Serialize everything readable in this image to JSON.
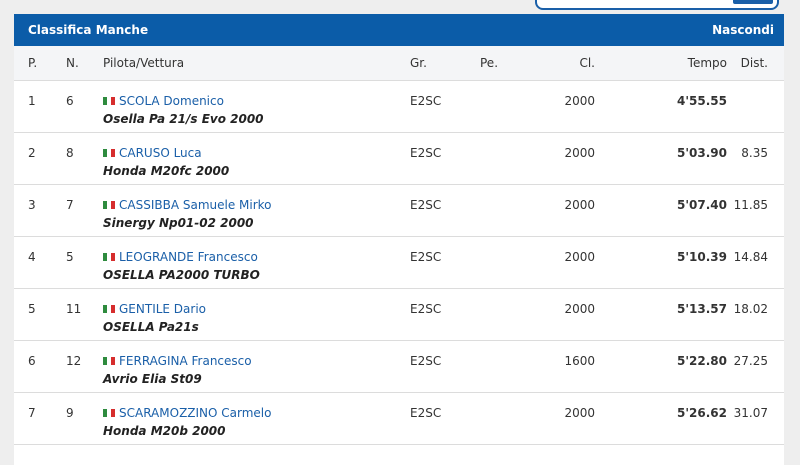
{
  "panel": {
    "title": "Classifica Manche",
    "toggle_label": "Nascondi"
  },
  "columns": {
    "pos": "P.",
    "num": "N.",
    "pilot": "Pilota/Vettura",
    "gr": "Gr.",
    "pe": "Pe.",
    "cl": "Cl.",
    "tempo": "Tempo",
    "dist": "Dist."
  },
  "rows": [
    {
      "pos": "1",
      "num": "6",
      "driver": "SCOLA Domenico",
      "car": "Osella Pa 21/s Evo 2000",
      "gr": "E2SC",
      "pe": "",
      "cl": "2000",
      "tempo": "4'55.55",
      "dist": ""
    },
    {
      "pos": "2",
      "num": "8",
      "driver": "CARUSO Luca",
      "car": "Honda M20fc 2000",
      "gr": "E2SC",
      "pe": "",
      "cl": "2000",
      "tempo": "5'03.90",
      "dist": "8.35"
    },
    {
      "pos": "3",
      "num": "7",
      "driver": "CASSIBBA Samuele Mirko",
      "car": "Sinergy Np01-02 2000",
      "gr": "E2SC",
      "pe": "",
      "cl": "2000",
      "tempo": "5'07.40",
      "dist": "11.85"
    },
    {
      "pos": "4",
      "num": "5",
      "driver": "LEOGRANDE Francesco",
      "car": "OSELLA PA2000 TURBO",
      "gr": "E2SC",
      "pe": "",
      "cl": "2000",
      "tempo": "5'10.39",
      "dist": "14.84"
    },
    {
      "pos": "5",
      "num": "11",
      "driver": "GENTILE Dario",
      "car": "OSELLA Pa21s",
      "gr": "E2SC",
      "pe": "",
      "cl": "2000",
      "tempo": "5'13.57",
      "dist": "18.02"
    },
    {
      "pos": "6",
      "num": "12",
      "driver": "FERRAGINA Francesco",
      "car": "Avrio Elia St09",
      "gr": "E2SC",
      "pe": "",
      "cl": "1600",
      "tempo": "5'22.80",
      "dist": "27.25"
    },
    {
      "pos": "7",
      "num": "9",
      "driver": "SCARAMOZZINO Carmelo",
      "car": "Honda M20b 2000",
      "gr": "E2SC",
      "pe": "",
      "cl": "2000",
      "tempo": "5'26.62",
      "dist": "31.07"
    }
  ],
  "flag_icon": "italy-flag-icon",
  "colors": {
    "header_bg": "#0b5ca8",
    "link": "#1a5fa8"
  }
}
